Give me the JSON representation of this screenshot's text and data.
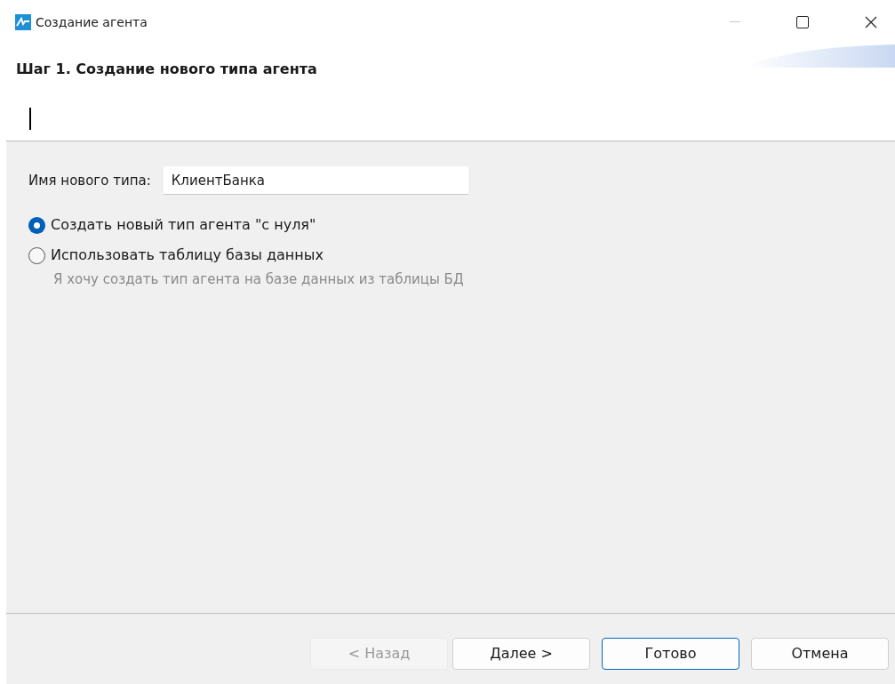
{
  "window": {
    "title": "Создание агента"
  },
  "header": {
    "title": "Шаг 1. Создание нового типа агента"
  },
  "name_field": {
    "label": "Имя нового типа:",
    "value": "КлиентБанка"
  },
  "options": [
    {
      "label": "Создать новый тип агента \"с нуля\"",
      "selected": true
    },
    {
      "label": "Использовать таблицу базы данных",
      "selected": false,
      "description": "Я хочу создать тип агента на базе данных из таблицы БД"
    }
  ],
  "buttons": [
    {
      "label": "< Назад",
      "disabled": true,
      "focused": false
    },
    {
      "label": "Далее >",
      "disabled": false,
      "focused": false
    },
    {
      "label": "Готово",
      "disabled": false,
      "focused": true
    },
    {
      "label": "Отмена",
      "disabled": false,
      "focused": false
    }
  ]
}
